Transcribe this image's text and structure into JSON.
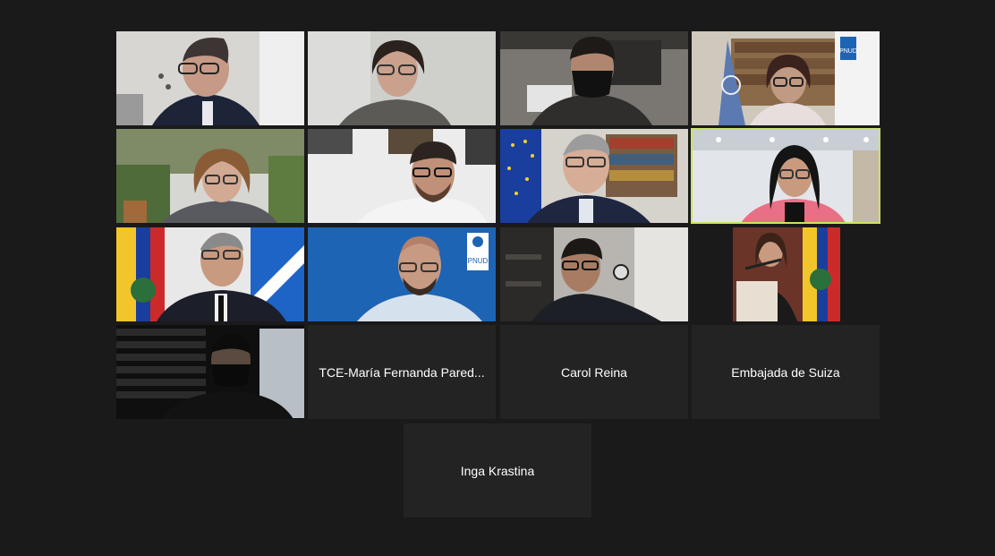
{
  "meeting": {
    "participants": [
      {
        "id": "p1",
        "type": "video",
        "description": "man with glasses, dark jacket, office"
      },
      {
        "id": "p2",
        "type": "video",
        "description": "woman with glasses, grey sweater, light wall"
      },
      {
        "id": "p3",
        "type": "video",
        "description": "man with black face mask"
      },
      {
        "id": "p4",
        "type": "video",
        "description": "woman with glasses, UN flag, PNUD banner"
      },
      {
        "id": "p5",
        "type": "video",
        "description": "woman with curly hair, garden background"
      },
      {
        "id": "p6",
        "type": "video",
        "description": "man with beard and glasses, white shirt"
      },
      {
        "id": "p7",
        "type": "video",
        "description": "older man with glasses, EU flag, bookshelf"
      },
      {
        "id": "p8",
        "type": "video",
        "description": "woman with pink jacket, office lights",
        "active_speaker": true
      },
      {
        "id": "p9",
        "type": "video",
        "description": "man in suit, Ecuador flag"
      },
      {
        "id": "p10",
        "type": "video",
        "description": "bald man with glasses, UNDP blue background"
      },
      {
        "id": "p11",
        "type": "video",
        "description": "man with glasses in office with clock"
      },
      {
        "id": "p12",
        "type": "video",
        "description": "woman at podium with microphone, Ecuador flag"
      },
      {
        "id": "p13",
        "type": "video",
        "description": "person wearing mask, dark room with blinds"
      }
    ],
    "name_tiles": [
      {
        "name": "TCE-María Fernanda Pared..."
      },
      {
        "name": "Carol Reina"
      },
      {
        "name": "Embajada de Suiza"
      },
      {
        "name": "Inga Krastina"
      }
    ],
    "pnud_logo_text": "PNUD",
    "colors": {
      "background": "#1a1a1a",
      "tile": "#232323",
      "active_speaker_border": "#c9e265",
      "undp_blue": "#1e64b4"
    }
  }
}
